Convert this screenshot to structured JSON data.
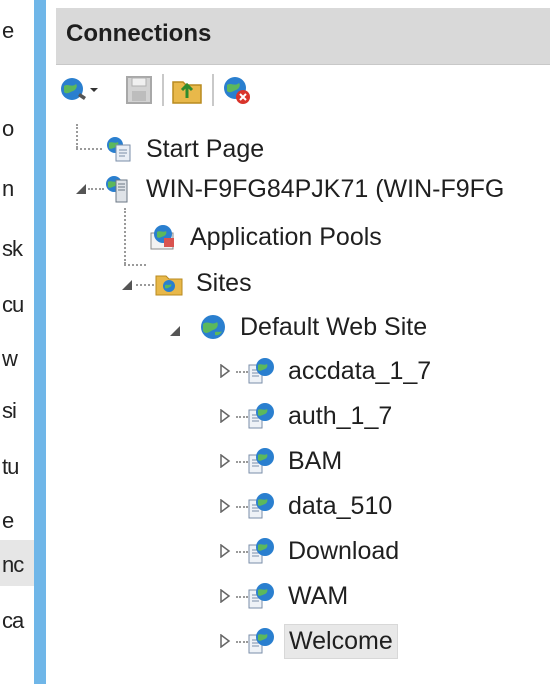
{
  "left_fragments": [
    "e",
    "o",
    "n",
    "sk",
    "cu",
    "w",
    "si",
    "tu",
    "e",
    "nc",
    "ca"
  ],
  "connections": {
    "title": "Connections",
    "toolbar": [
      {
        "name": "connect-icon"
      },
      {
        "name": "save-icon"
      },
      {
        "name": "up-folder-icon"
      },
      {
        "name": "disconnect-icon"
      }
    ]
  },
  "tree": {
    "start_page": "Start Page",
    "server": "WIN-F9FG84PJK71 (WIN-F9FG",
    "app_pools": "Application Pools",
    "sites": "Sites",
    "default_site": "Default Web Site",
    "apps": [
      "accdata_1_7",
      "auth_1_7",
      "BAM",
      "data_510",
      "Download",
      "WAM",
      "Welcome"
    ],
    "selected": "Welcome"
  },
  "colors": {
    "accent_bar": "#6fb6e8",
    "header_bg": "#d9d9d9",
    "globe": "#2a7fcf"
  }
}
